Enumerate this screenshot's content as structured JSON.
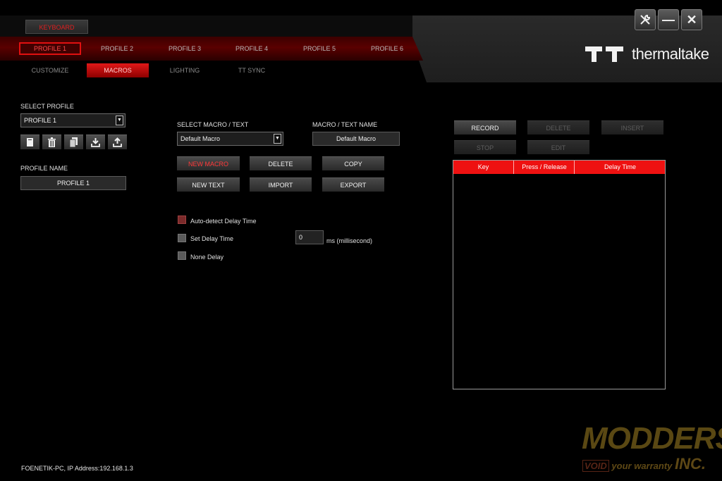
{
  "keyboard_tab": "KEYBOARD",
  "profiles": [
    "PROFILE 1",
    "PROFILE 2",
    "PROFILE 3",
    "PROFILE 4",
    "PROFILE 5",
    "PROFILE 6"
  ],
  "sections": [
    "CUSTOMIZE",
    "MACROS",
    "LIGHTING",
    "TT SYNC"
  ],
  "brand": "thermaltake",
  "window_buttons": {
    "settings": "settings-icon",
    "minimize": "minimize-icon",
    "close": "close-icon"
  },
  "left": {
    "select_profile_label": "SELECT PROFILE",
    "selected_profile": "PROFILE 1",
    "profile_name_label": "PROFILE NAME",
    "profile_name_value": "PROFILE 1",
    "icon_buttons": [
      "new-profile-icon",
      "trash-icon",
      "copy-profile-icon",
      "import-download-icon",
      "export-upload-icon"
    ]
  },
  "macro": {
    "select_label": "SELECT MACRO / TEXT",
    "selected_macro": "Default Macro",
    "name_label": "MACRO / TEXT NAME",
    "name_value": "Default Macro",
    "buttons": {
      "new_macro": "NEW MACRO",
      "delete": "DELETE",
      "copy": "COPY",
      "new_text": "NEW TEXT",
      "import": "IMPORT",
      "export": "EXPORT"
    },
    "options": {
      "auto_detect": "Auto-detect Delay Time",
      "set_delay": "Set Delay Time",
      "delay_value": "0",
      "delay_unit": "ms (millisecond)",
      "none_delay": "None Delay"
    },
    "selected_option": "auto_detect"
  },
  "recorder": {
    "record": "RECORD",
    "delete": "DELETE",
    "insert": "INSERT",
    "stop": "STOP",
    "edit": "EDIT",
    "columns": [
      "Key",
      "Press / Release",
      "Delay Time"
    ],
    "rows": []
  },
  "status": "FOENETIK-PC, IP Address:192.168.1.3",
  "watermark": {
    "title": "MODDERS",
    "tag1": "VOID",
    "tag2": "your warranty",
    "suffix": "INC."
  },
  "colors": {
    "accent": "#ee1111",
    "dark_red": "#5a0000"
  }
}
